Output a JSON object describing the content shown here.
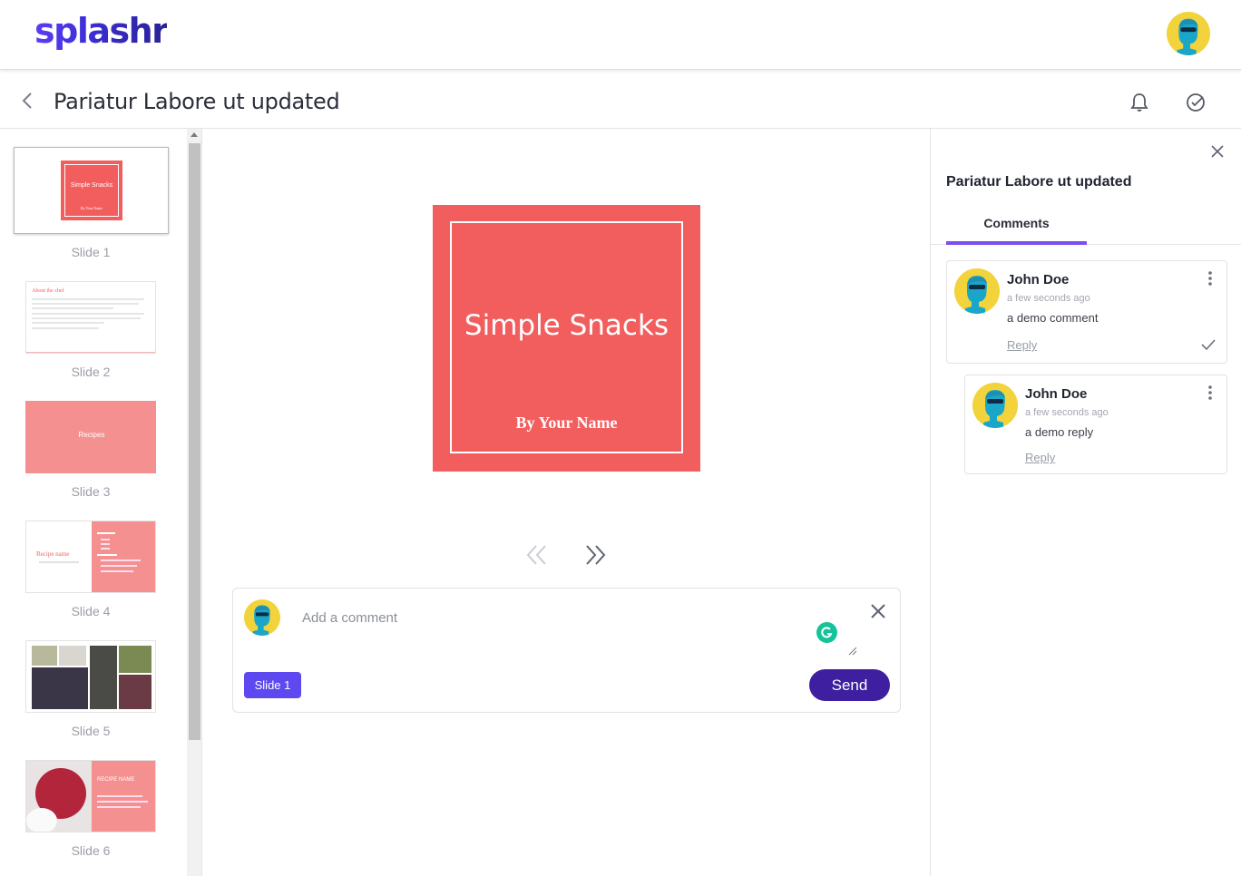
{
  "app": {
    "logo": "splashr"
  },
  "header": {
    "title": "Pariatur Labore ut updated"
  },
  "slides": [
    {
      "label": "Slide 1",
      "thumb_title": "Simple Snacks",
      "thumb_sub": "By Your Name"
    },
    {
      "label": "Slide 2",
      "thumb_title": "About the chef"
    },
    {
      "label": "Slide 3",
      "thumb_title": "Recipes"
    },
    {
      "label": "Slide 4",
      "thumb_title": "Recipe name"
    },
    {
      "label": "Slide 5"
    },
    {
      "label": "Slide 6",
      "thumb_title": "RECIPE NAME"
    }
  ],
  "preview": {
    "title": "Simple Snacks",
    "subtitle": "By Your Name"
  },
  "composer": {
    "placeholder": "Add a comment",
    "slide_tag": "Slide 1",
    "send_label": "Send"
  },
  "panel": {
    "title": "Pariatur Labore ut updated",
    "tab": "Comments",
    "comments": [
      {
        "name": "John Doe",
        "time": "a few seconds ago",
        "text": "a demo comment",
        "reply": "Reply"
      },
      {
        "name": "John Doe",
        "time": "a few seconds ago",
        "text": "a demo reply",
        "reply": "Reply"
      }
    ]
  },
  "colors": {
    "accent": "#5e48ef",
    "send": "#3e1fa0",
    "slide": "#f25e5e",
    "tab_underline": "#7c4df0"
  }
}
